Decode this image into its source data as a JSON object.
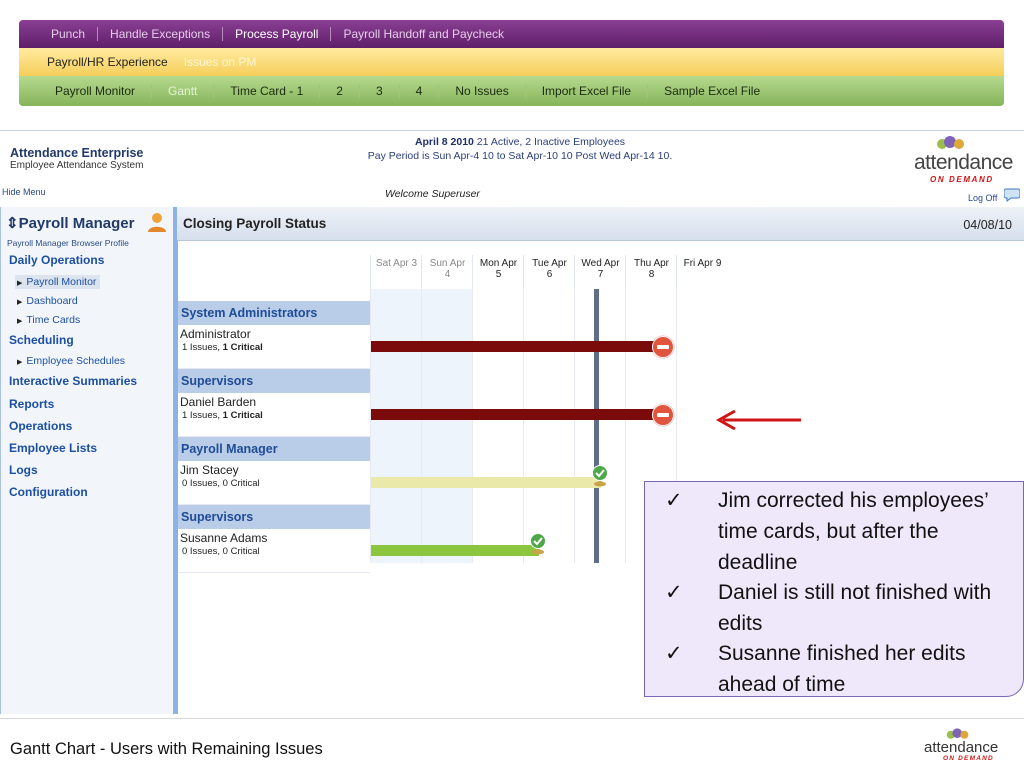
{
  "nav": {
    "row1": [
      "Punch",
      "Handle Exceptions",
      "Process Payroll",
      "Payroll Handoff and Paycheck"
    ],
    "row1_active": "Process Payroll",
    "row2": [
      "Payroll/HR Experience",
      "Issues on PM"
    ],
    "row3": [
      "Payroll Monitor",
      "Gantt",
      "Time Card - 1",
      "2",
      "3",
      "4",
      "No Issues",
      "Import Excel File",
      "Sample Excel File"
    ]
  },
  "header": {
    "brand_title": "Attendance Enterprise",
    "brand_sub": "Employee Attendance System",
    "hide_menu": "Hide Menu",
    "date_bold": "April 8 2010",
    "date_rest": " 21 Active, 2 Inactive Employees",
    "pay_period": "Pay Period is Sun Apr-4 10 to Sat Apr-10 10 Post Wed Apr-14 10.",
    "welcome": "Welcome Superuser",
    "logo_word": "attendance",
    "logo_tag": "ON DEMAND",
    "log_off": "Log Off"
  },
  "sidebar": {
    "title": "Payroll Manager",
    "title_prefix": "⇕",
    "profile": "Payroll Manager Browser Profile",
    "daily_operations": "Daily Operations",
    "payroll_monitor": "Payroll Monitor",
    "dashboard": "Dashboard",
    "time_cards": "Time Cards",
    "scheduling": "Scheduling",
    "employee_schedules": "Employee Schedules",
    "interactive_summaries": "Interactive Summaries",
    "reports": "Reports",
    "operations": "Operations",
    "employee_lists": "Employee Lists",
    "logs": "Logs",
    "configuration": "Configuration"
  },
  "main": {
    "title": "Closing Payroll Status",
    "date": "04/08/10"
  },
  "gantt": {
    "days": [
      {
        "l1": "Sat Apr 3",
        "l2": "",
        "weekend": true
      },
      {
        "l1": "Sun Apr",
        "l2": "4",
        "weekend": true
      },
      {
        "l1": "Mon Apr",
        "l2": "5",
        "weekend": false
      },
      {
        "l1": "Tue Apr",
        "l2": "6",
        "weekend": false
      },
      {
        "l1": "Wed Apr",
        "l2": "7",
        "weekend": false
      },
      {
        "l1": "Thu Apr",
        "l2": "8",
        "weekend": false
      },
      {
        "l1": "Fri Apr 9",
        "l2": "",
        "weekend": false
      }
    ],
    "groups": [
      {
        "name": "System Administrators",
        "person": "Administrator",
        "issues": "1 Issues,",
        "critical": "1 Critical",
        "critical_bold": true,
        "bar_color": "#7b0a0a",
        "bar_end_day": 5.75,
        "status": "critical"
      },
      {
        "name": "Supervisors",
        "person": "Daniel Barden",
        "issues": "1 Issues,",
        "critical": "1 Critical",
        "critical_bold": true,
        "bar_color": "#7b0a0a",
        "bar_end_day": 5.75,
        "status": "critical"
      },
      {
        "name": "Payroll Manager",
        "person": "Jim Stacey",
        "issues": "0 Issues,",
        "critical": "0 Critical",
        "critical_bold": false,
        "bar_color": "#ebe9a9",
        "bar_end_day": 4.5,
        "status": "done"
      },
      {
        "name": "Supervisors",
        "person": "Susanne Adams",
        "issues": "0 Issues,",
        "critical": "0 Critical",
        "critical_bold": false,
        "bar_color": "#8cc63f",
        "bar_end_day": 3.3,
        "status": "done"
      }
    ]
  },
  "callout": {
    "check": "✓",
    "items": [
      "Jim corrected his employees’ time cards, but after the deadline",
      "Daniel is still not finished with edits",
      "Susanne finished her edits ahead of time"
    ]
  },
  "footer": {
    "title": "Gantt Chart - Users with Remaining Issues",
    "logo_word": "attendance",
    "logo_tag": "ON DEMAND"
  },
  "colors": {
    "nav1": "#6b2a75",
    "nav2": "#f9db78",
    "nav3": "#95bf68",
    "critical_bar": "#7b0a0a",
    "arrow": "#d01515"
  }
}
